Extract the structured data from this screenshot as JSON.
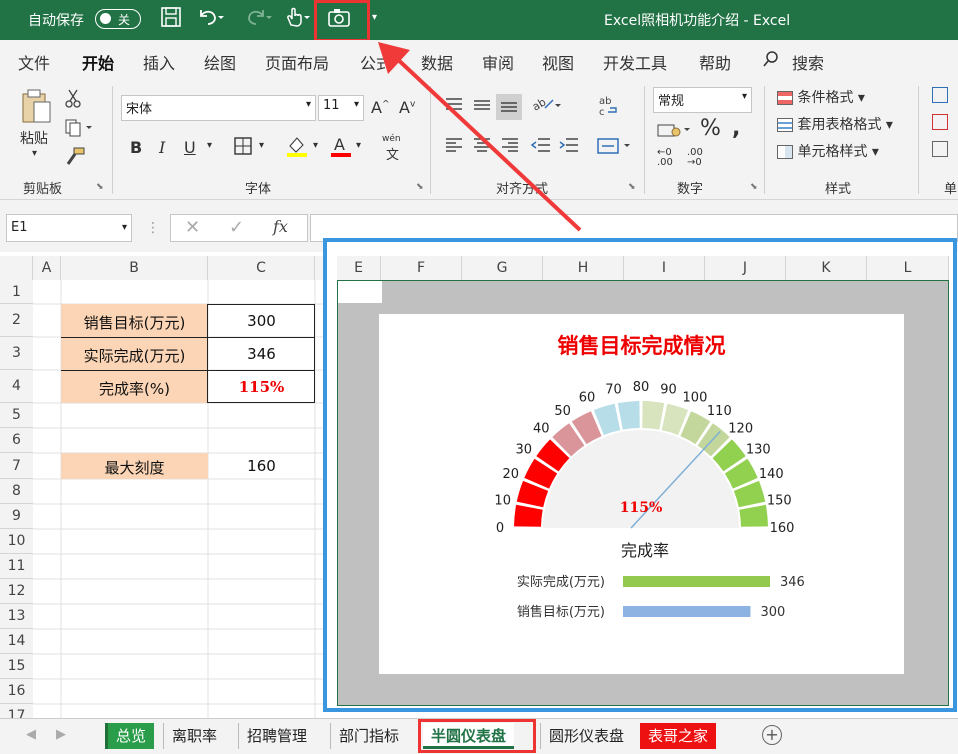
{
  "titlebar": {
    "autosave_label": "自动保存",
    "autosave_state": "关",
    "title": "Excel照相机功能介绍  -  Excel"
  },
  "menu": [
    "文件",
    "开始",
    "插入",
    "绘图",
    "页面布局",
    "公式",
    "数据",
    "审阅",
    "视图",
    "开发工具",
    "帮助",
    "搜索"
  ],
  "ribbon": {
    "clipboard": {
      "paste": "粘贴",
      "group": "剪贴板"
    },
    "font": {
      "name": "宋体",
      "size": "11",
      "group": "字体",
      "wen": "wén",
      "wen_char": "文"
    },
    "alignment": {
      "group": "对齐方式"
    },
    "number": {
      "format": "常规",
      "group": "数字"
    },
    "styles": {
      "cond": "条件格式",
      "table": "套用表格格式",
      "cell": "单元格样式",
      "group": "样式"
    },
    "cells": {
      "group": "单"
    }
  },
  "formula": {
    "namebox": "E1",
    "fx": "fx"
  },
  "columns": [
    "A",
    "B",
    "C",
    "E",
    "F",
    "G",
    "H",
    "I",
    "J",
    "K",
    "L"
  ],
  "rows": [
    "1",
    "2",
    "3",
    "4",
    "5",
    "6",
    "7",
    "8",
    "9",
    "10",
    "11",
    "12",
    "13",
    "14",
    "15",
    "16",
    "17"
  ],
  "table": {
    "r2": {
      "label": "销售目标(万元)",
      "value": "300"
    },
    "r3": {
      "label": "实际完成(万元)",
      "value": "346"
    },
    "r4": {
      "label": "完成率(%)",
      "value": "115%"
    },
    "r7": {
      "label": "最大刻度",
      "value": "160"
    }
  },
  "chart_data": {
    "type": "gauge",
    "title": "销售目标完成情况",
    "center_label": "115%",
    "subtitle": "完成率",
    "ticks": [
      "0",
      "10",
      "20",
      "30",
      "40",
      "50",
      "60",
      "70",
      "80",
      "90",
      "100",
      "110",
      "120",
      "130",
      "140",
      "150",
      "160"
    ],
    "min": 0,
    "max": 160,
    "needle_value": 115,
    "bars": [
      {
        "name": "实际完成(万元)",
        "value": 346,
        "color": "#92c94e"
      },
      {
        "name": "销售目标(万元)",
        "value": 300,
        "color": "#8db3e2"
      }
    ],
    "band_colors": [
      "#ff0000",
      "#ff0000",
      "#ff0000",
      "#ff0000",
      "#d9959a",
      "#d9959a",
      "#b7dde8",
      "#b7dde8",
      "#d7e4bd",
      "#d7e4bd",
      "#c3d69b",
      "#c3d69b",
      "#92d050",
      "#92d050",
      "#92d050",
      "#92d050"
    ]
  },
  "sheets": [
    "总览",
    "离职率",
    "招聘管理",
    "部门指标",
    "半圆仪表盘",
    "圆形仪表盘",
    "表哥之家"
  ]
}
